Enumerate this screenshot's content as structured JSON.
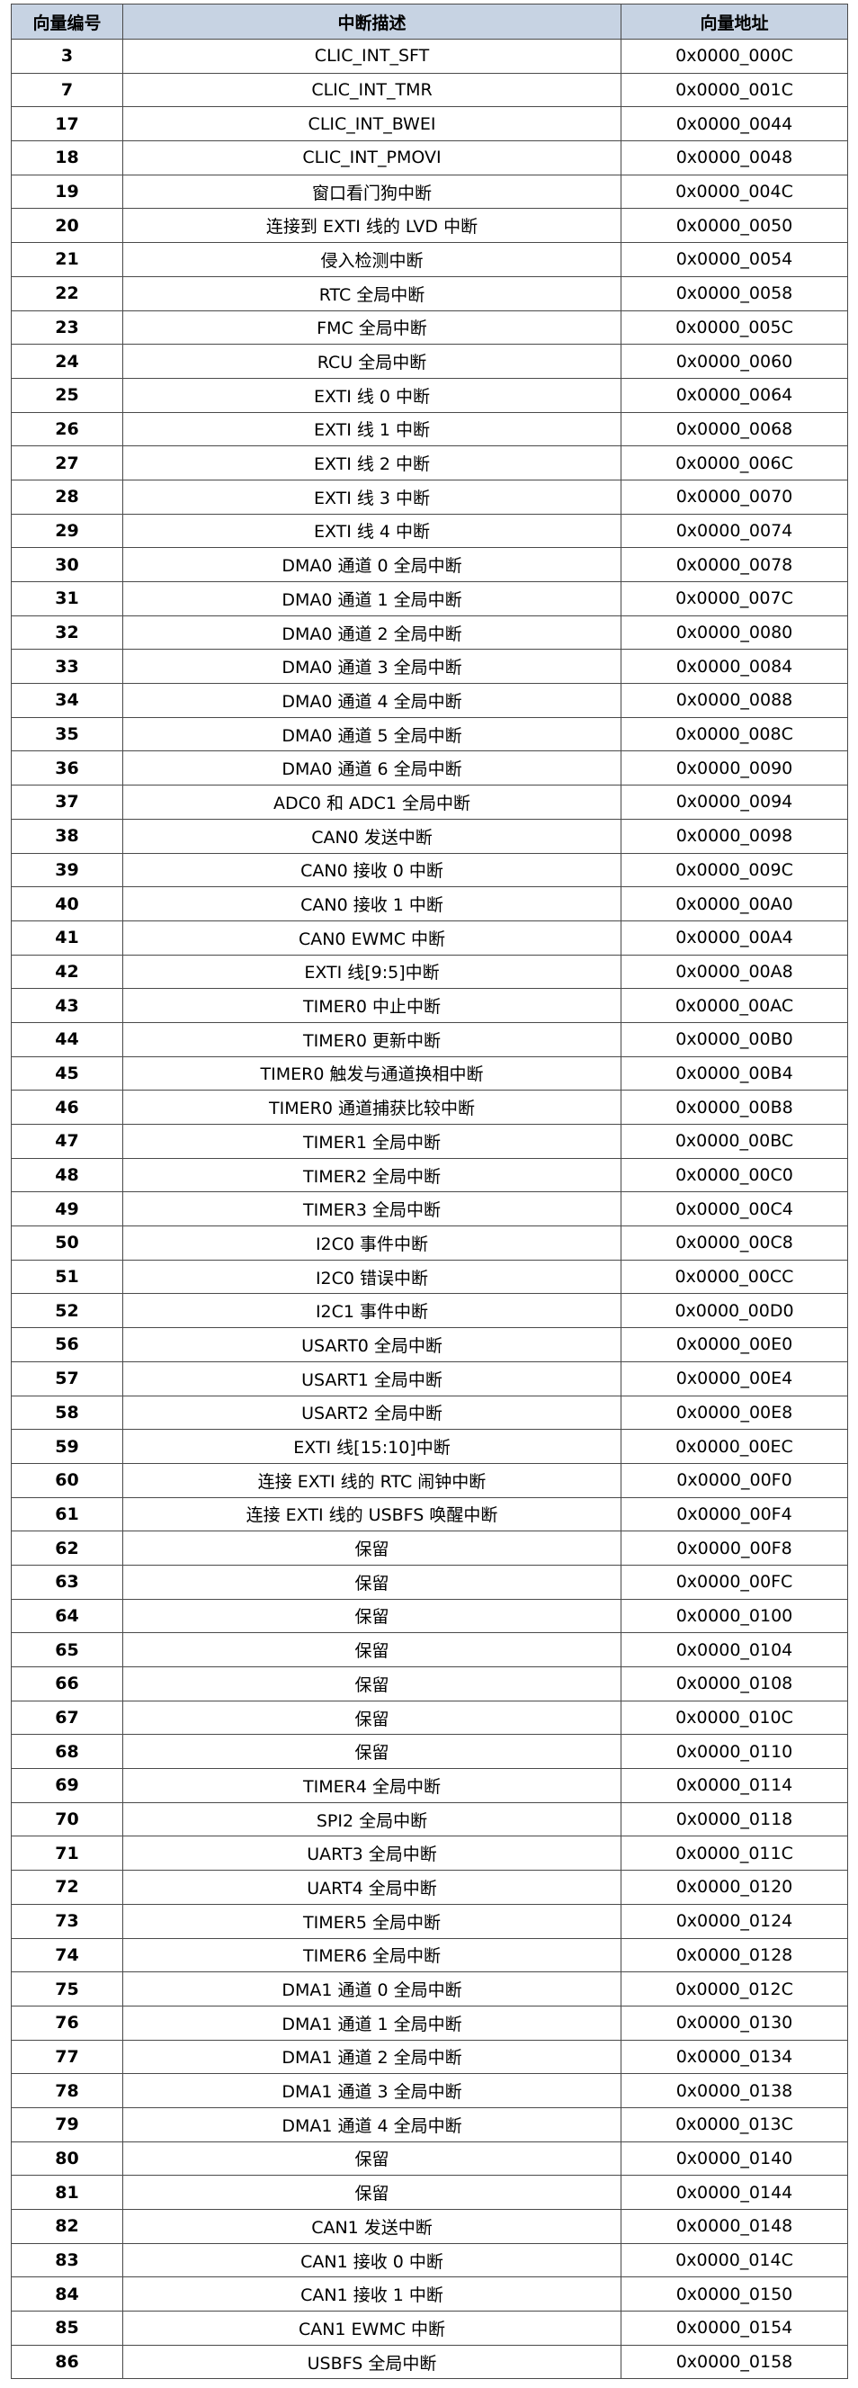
{
  "headers": {
    "number": "向量编号",
    "description": "中断描述",
    "address": "向量地址"
  },
  "rows": [
    {
      "num": "3",
      "desc": "CLIC_INT_SFT",
      "addr": "0x0000_000C"
    },
    {
      "num": "7",
      "desc": "CLIC_INT_TMR",
      "addr": "0x0000_001C"
    },
    {
      "num": "17",
      "desc": "CLIC_INT_BWEI",
      "addr": "0x0000_0044"
    },
    {
      "num": "18",
      "desc": "CLIC_INT_PMOVI",
      "addr": "0x0000_0048"
    },
    {
      "num": "19",
      "desc": "窗口看门狗中断",
      "addr": "0x0000_004C"
    },
    {
      "num": "20",
      "desc": "连接到 EXTI 线的 LVD 中断",
      "addr": "0x0000_0050"
    },
    {
      "num": "21",
      "desc": "侵入检测中断",
      "addr": "0x0000_0054"
    },
    {
      "num": "22",
      "desc": "RTC 全局中断",
      "addr": "0x0000_0058"
    },
    {
      "num": "23",
      "desc": "FMC 全局中断",
      "addr": "0x0000_005C"
    },
    {
      "num": "24",
      "desc": "RCU 全局中断",
      "addr": "0x0000_0060"
    },
    {
      "num": "25",
      "desc": "EXTI 线 0 中断",
      "addr": "0x0000_0064"
    },
    {
      "num": "26",
      "desc": "EXTI 线 1 中断",
      "addr": "0x0000_0068"
    },
    {
      "num": "27",
      "desc": "EXTI 线 2 中断",
      "addr": "0x0000_006C"
    },
    {
      "num": "28",
      "desc": "EXTI 线 3 中断",
      "addr": "0x0000_0070"
    },
    {
      "num": "29",
      "desc": "EXTI 线 4 中断",
      "addr": "0x0000_0074"
    },
    {
      "num": "30",
      "desc": "DMA0 通道 0 全局中断",
      "addr": "0x0000_0078"
    },
    {
      "num": "31",
      "desc": "DMA0 通道 1 全局中断",
      "addr": "0x0000_007C"
    },
    {
      "num": "32",
      "desc": "DMA0 通道 2 全局中断",
      "addr": "0x0000_0080"
    },
    {
      "num": "33",
      "desc": "DMA0 通道 3 全局中断",
      "addr": "0x0000_0084"
    },
    {
      "num": "34",
      "desc": "DMA0 通道 4 全局中断",
      "addr": "0x0000_0088"
    },
    {
      "num": "35",
      "desc": "DMA0 通道 5 全局中断",
      "addr": "0x0000_008C"
    },
    {
      "num": "36",
      "desc": "DMA0 通道 6 全局中断",
      "addr": "0x0000_0090"
    },
    {
      "num": "37",
      "desc": "ADC0 和 ADC1 全局中断",
      "addr": "0x0000_0094"
    },
    {
      "num": "38",
      "desc": "CAN0 发送中断",
      "addr": "0x0000_0098"
    },
    {
      "num": "39",
      "desc": "CAN0 接收 0 中断",
      "addr": "0x0000_009C"
    },
    {
      "num": "40",
      "desc": "CAN0 接收 1 中断",
      "addr": "0x0000_00A0"
    },
    {
      "num": "41",
      "desc": "CAN0 EWMC 中断",
      "addr": "0x0000_00A4"
    },
    {
      "num": "42",
      "desc": "EXTI 线[9:5]中断",
      "addr": "0x0000_00A8"
    },
    {
      "num": "43",
      "desc": "TIMER0 中止中断",
      "addr": "0x0000_00AC"
    },
    {
      "num": "44",
      "desc": "TIMER0 更新中断",
      "addr": "0x0000_00B0"
    },
    {
      "num": "45",
      "desc": "TIMER0 触发与通道换相中断",
      "addr": "0x0000_00B4"
    },
    {
      "num": "46",
      "desc": "TIMER0 通道捕获比较中断",
      "addr": "0x0000_00B8"
    },
    {
      "num": "47",
      "desc": "TIMER1 全局中断",
      "addr": "0x0000_00BC"
    },
    {
      "num": "48",
      "desc": "TIMER2 全局中断",
      "addr": "0x0000_00C0"
    },
    {
      "num": "49",
      "desc": "TIMER3 全局中断",
      "addr": "0x0000_00C4"
    },
    {
      "num": "50",
      "desc": "I2C0 事件中断",
      "addr": "0x0000_00C8"
    },
    {
      "num": "51",
      "desc": "I2C0 错误中断",
      "addr": "0x0000_00CC"
    },
    {
      "num": "52",
      "desc": "I2C1 事件中断",
      "addr": "0x0000_00D0"
    },
    {
      "num": "56",
      "desc": "USART0 全局中断",
      "addr": "0x0000_00E0"
    },
    {
      "num": "57",
      "desc": "USART1 全局中断",
      "addr": "0x0000_00E4"
    },
    {
      "num": "58",
      "desc": "USART2 全局中断",
      "addr": "0x0000_00E8"
    },
    {
      "num": "59",
      "desc": "EXTI 线[15:10]中断",
      "addr": "0x0000_00EC"
    },
    {
      "num": "60",
      "desc": "连接 EXTI 线的 RTC 闹钟中断",
      "addr": "0x0000_00F0"
    },
    {
      "num": "61",
      "desc": "连接 EXTI 线的 USBFS 唤醒中断",
      "addr": "0x0000_00F4"
    },
    {
      "num": "62",
      "desc": "保留",
      "addr": "0x0000_00F8"
    },
    {
      "num": "63",
      "desc": "保留",
      "addr": "0x0000_00FC"
    },
    {
      "num": "64",
      "desc": "保留",
      "addr": "0x0000_0100"
    },
    {
      "num": "65",
      "desc": "保留",
      "addr": "0x0000_0104"
    },
    {
      "num": "66",
      "desc": "保留",
      "addr": "0x0000_0108"
    },
    {
      "num": "67",
      "desc": "保留",
      "addr": "0x0000_010C"
    },
    {
      "num": "68",
      "desc": "保留",
      "addr": "0x0000_0110"
    },
    {
      "num": "69",
      "desc": "TIMER4 全局中断",
      "addr": "0x0000_0114"
    },
    {
      "num": "70",
      "desc": "SPI2 全局中断",
      "addr": "0x0000_0118"
    },
    {
      "num": "71",
      "desc": "UART3 全局中断",
      "addr": "0x0000_011C"
    },
    {
      "num": "72",
      "desc": "UART4 全局中断",
      "addr": "0x0000_0120"
    },
    {
      "num": "73",
      "desc": "TIMER5 全局中断",
      "addr": "0x0000_0124"
    },
    {
      "num": "74",
      "desc": "TIMER6 全局中断",
      "addr": "0x0000_0128"
    },
    {
      "num": "75",
      "desc": "DMA1 通道 0 全局中断",
      "addr": "0x0000_012C"
    },
    {
      "num": "76",
      "desc": "DMA1 通道 1 全局中断",
      "addr": "0x0000_0130"
    },
    {
      "num": "77",
      "desc": "DMA1 通道 2 全局中断",
      "addr": "0x0000_0134"
    },
    {
      "num": "78",
      "desc": "DMA1 通道 3 全局中断",
      "addr": "0x0000_0138"
    },
    {
      "num": "79",
      "desc": "DMA1 通道 4 全局中断",
      "addr": "0x0000_013C"
    },
    {
      "num": "80",
      "desc": "保留",
      "addr": "0x0000_0140"
    },
    {
      "num": "81",
      "desc": "保留",
      "addr": "0x0000_0144"
    },
    {
      "num": "82",
      "desc": "CAN1 发送中断",
      "addr": "0x0000_0148"
    },
    {
      "num": "83",
      "desc": "CAN1 接收 0 中断",
      "addr": "0x0000_014C"
    },
    {
      "num": "84",
      "desc": "CAN1 接收 1 中断",
      "addr": "0x0000_0150"
    },
    {
      "num": "85",
      "desc": "CAN1 EWMC 中断",
      "addr": "0x0000_0154"
    },
    {
      "num": "86",
      "desc": "USBFS 全局中断",
      "addr": "0x0000_0158"
    }
  ]
}
